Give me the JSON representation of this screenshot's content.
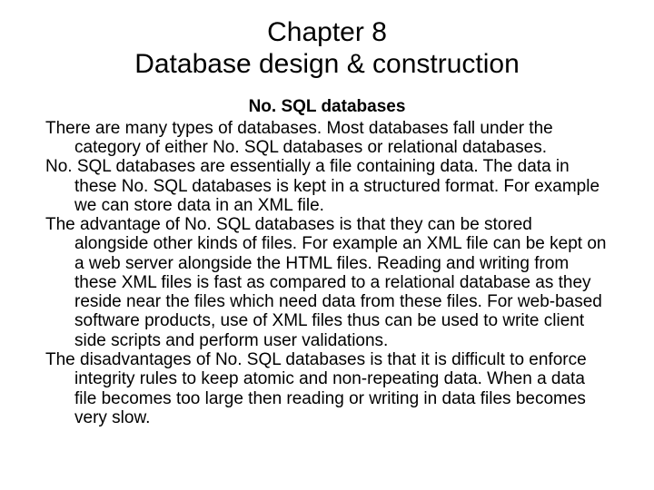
{
  "title": {
    "line1": "Chapter 8",
    "line2": "Database design & construction"
  },
  "subheading": "No. SQL databases",
  "paragraphs": [
    "There are many types of databases. Most databases fall under the category of either No. SQL databases or relational databases.",
    "No. SQL databases are essentially a file containing data. The data in these No. SQL databases is kept in a structured format. For example we can store data in an XML file.",
    "The advantage of No. SQL databases is that they can be stored alongside other kinds of files. For example an XML file can be kept on a web server alongside the HTML files. Reading and writing from these XML files is fast as compared to a relational database as they reside near the files which need data from these files. For web-based software products, use of XML files thus can be used to write client side scripts and perform user validations.",
    "The disadvantages of No. SQL databases is that it is difficult to enforce integrity rules to keep atomic and non-repeating data. When a data file becomes too large then reading or writing in data files becomes very slow."
  ]
}
